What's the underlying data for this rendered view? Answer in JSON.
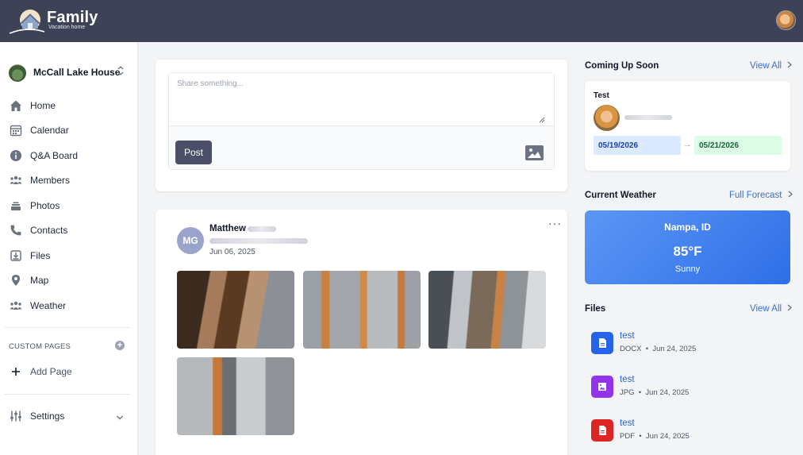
{
  "header": {
    "logo_title": "Family",
    "logo_subtitle": "Vacation home"
  },
  "sidebar": {
    "property_name": "McCall Lake House",
    "items": [
      {
        "label": "Home",
        "icon": "home-icon"
      },
      {
        "label": "Calendar",
        "icon": "calendar-icon"
      },
      {
        "label": "Q&A Board",
        "icon": "info-icon"
      },
      {
        "label": "Members",
        "icon": "members-icon"
      },
      {
        "label": "Photos",
        "icon": "photos-icon"
      },
      {
        "label": "Contacts",
        "icon": "phone-icon"
      },
      {
        "label": "Files",
        "icon": "files-icon"
      },
      {
        "label": "Map",
        "icon": "map-pin-icon"
      },
      {
        "label": "Weather",
        "icon": "weather-icon"
      }
    ],
    "custom_pages_title": "CUSTOM PAGES",
    "add_page_label": "Add Page",
    "settings_label": "Settings"
  },
  "composer": {
    "placeholder": "Share something...",
    "post_label": "Post"
  },
  "post": {
    "avatar_initials": "MG",
    "author": "Matthew",
    "date": "Jun 06, 2025",
    "more": "···"
  },
  "coming_up": {
    "title": "Coming Up Soon",
    "link": "View All",
    "event_title": "Test",
    "start_date": "05/19/2026",
    "end_date": "05/21/2026"
  },
  "weather": {
    "title": "Current Weather",
    "link": "Full Forecast",
    "city": "Nampa, ID",
    "temperature": "85°F",
    "condition": "Sunny"
  },
  "files": {
    "title": "Files",
    "link": "View All",
    "items": [
      {
        "name": "test",
        "type": "DOCX",
        "date": "Jun 24, 2025",
        "color": "#2563eb",
        "icon": "document-icon"
      },
      {
        "name": "test",
        "type": "JPG",
        "date": "Jun 24, 2025",
        "color": "#9333ea",
        "icon": "image-icon"
      },
      {
        "name": "test",
        "type": "PDF",
        "date": "Jun 24, 2025",
        "color": "#dc2626",
        "icon": "pdf-icon"
      }
    ]
  }
}
